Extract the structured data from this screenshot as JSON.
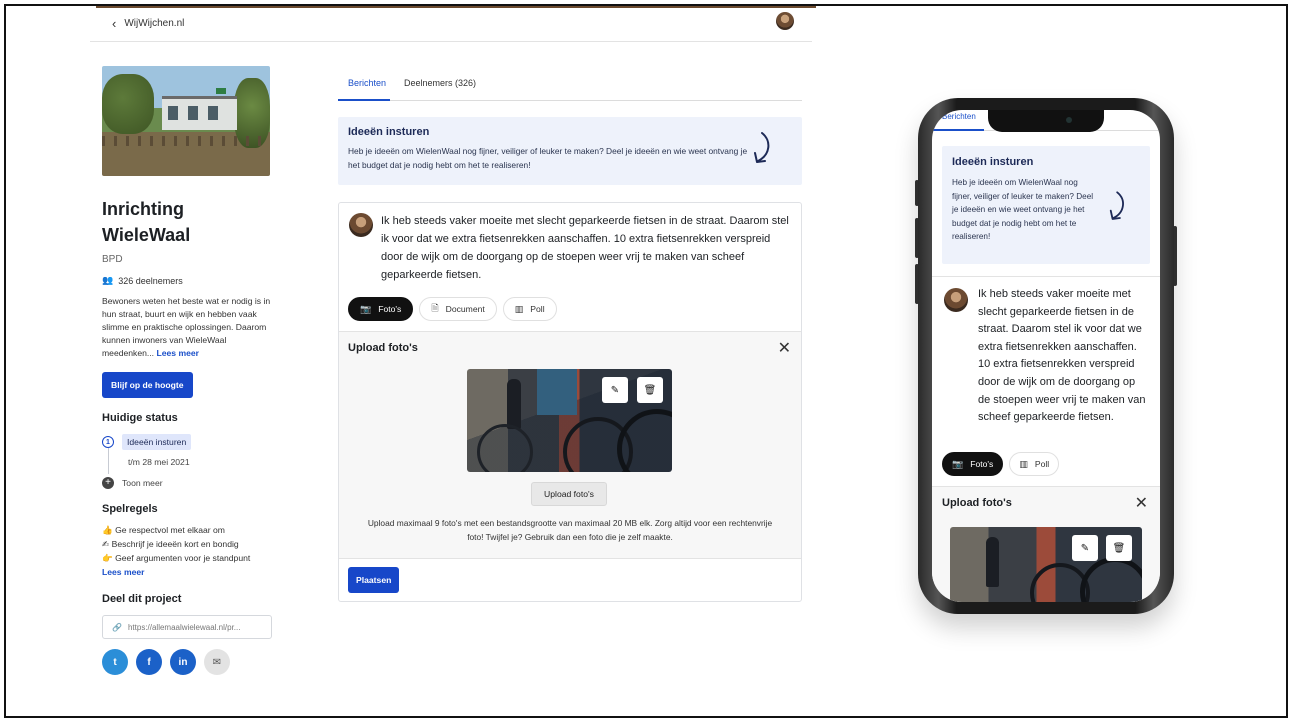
{
  "topbar": {
    "back_label": "WijWijchen.nl"
  },
  "project": {
    "title": "Inrichting WieleWaal",
    "org": "BPD",
    "members": "326 deelnemers",
    "description": "Bewoners weten het beste wat er nodig is in hun straat, buurt en wijk en hebben vaak slimme en praktische oplossingen. Daarom kunnen inwoners van WieleWaal meedenken...",
    "read_more": "Lees meer",
    "follow_button": "Blijf op de hoogte"
  },
  "status": {
    "heading": "Huidige status",
    "step_number": "1",
    "current": "Ideeën insturen",
    "until": "t/m 28 mei 2021",
    "show_more": "Toon meer"
  },
  "rules": {
    "heading": "Spelregels",
    "items": [
      "👍 Ge respectvol met elkaar om",
      "✍ Beschrijf je ideeën kort en bondig",
      "👉 Geef argumenten voor je standpunt"
    ],
    "read_more": "Lees meer"
  },
  "share": {
    "heading": "Deel dit project",
    "url": "https://allemaalwielewaal.nl/pr...",
    "twitter": "t",
    "facebook": "f",
    "linkedin": "in",
    "mail": "✉"
  },
  "tabs": [
    {
      "label": "Berichten",
      "active": true
    },
    {
      "label": "Deelnemers (326)",
      "active": false
    }
  ],
  "idea_box": {
    "heading": "Ideeën insturen",
    "text": "Heb je ideeën om WielenWaal nog fijner, veiliger of leuker te maken? Deel je ideeën en wie weet ontvang je het budget dat je nodig hebt om het te realiseren!"
  },
  "post": {
    "text": "Ik heb steeds vaker moeite met slecht geparkeerde fietsen in de straat. Daarom stel ik voor dat we extra fietsenrekken aanschaffen. 10 extra fietsenrekken verspreid door de wijk om de doorgang op de stoepen weer vrij te maken van scheef geparkeerde fietsen.",
    "attachments": [
      "Foto's",
      "Document",
      "Poll"
    ],
    "upload_heading": "Upload foto's",
    "upload_button": "Upload foto's",
    "upload_note": "Upload maximaal 9 foto's met een bestandsgrootte van maximaal 20 MB elk. Zorg altijd voor een rechtenvrije foto! Twijfel je? Gebruik dan een foto die je zelf maakte.",
    "submit_button": "Plaatsen"
  },
  "mobile": {
    "tab_label": "Berichten",
    "attachments": [
      "Foto's",
      "Poll"
    ]
  },
  "colors": {
    "accent": "#1747c9",
    "info_bg": "#eef2fb"
  }
}
